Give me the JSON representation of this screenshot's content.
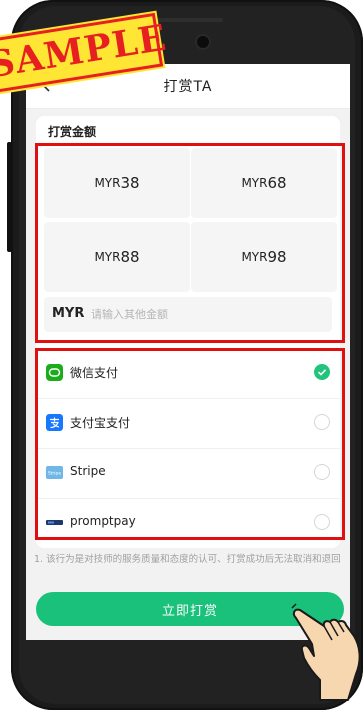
{
  "watermark": "SAMPLE",
  "nav": {
    "title": "打赏TA"
  },
  "amount": {
    "section_title": "打赏金额",
    "options": [
      {
        "currency": "MYR",
        "value": "38"
      },
      {
        "currency": "MYR",
        "value": "68"
      },
      {
        "currency": "MYR",
        "value": "88"
      },
      {
        "currency": "MYR",
        "value": "98"
      }
    ],
    "custom": {
      "prefix": "MYR",
      "placeholder": "请输入其他金额",
      "value": ""
    }
  },
  "payment": {
    "methods": [
      {
        "label": "微信支付",
        "icon": "wechat-pay-icon",
        "selected": true
      },
      {
        "label": "支付宝支付",
        "icon": "alipay-icon",
        "selected": false
      },
      {
        "label": "Stripe",
        "icon": "stripe-icon",
        "icon_text": "Stripe",
        "selected": false
      },
      {
        "label": "promptpay",
        "icon": "promptpay-icon",
        "selected": false
      }
    ]
  },
  "notice": "1. 该行为是对技师的服务质量和态度的认可、打赏成功后无法取消和退回",
  "submit": {
    "label": "立即打赏"
  },
  "colors": {
    "accent": "#19c17b",
    "highlight": "#e01010",
    "stamp_bg": "#ffe534"
  }
}
